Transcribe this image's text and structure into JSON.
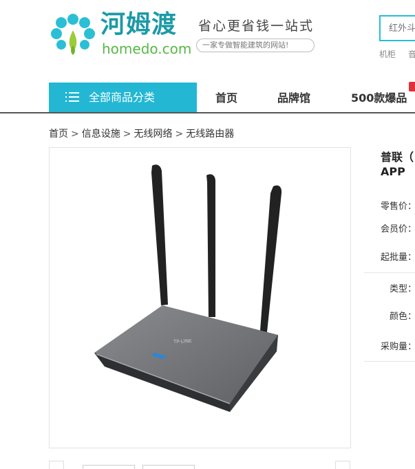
{
  "header": {
    "brand_cn": "河姆渡",
    "brand_en": "homedo.com",
    "slogan": "省心更省钱一站式",
    "sub_slogan": "一家专做智能建筑的网站!",
    "search_placeholder": "红外斗",
    "hot_words": [
      "机柜",
      "音"
    ]
  },
  "nav": {
    "category_label": "全部商品分类",
    "items": [
      "首页",
      "品牌馆",
      "500款爆品"
    ]
  },
  "breadcrumb": {
    "items": [
      "首页",
      "信息设施",
      "无线网络",
      "无线路由器"
    ],
    "separator": ">"
  },
  "product": {
    "title": "普联（ APP",
    "image_brand": "TP-LINK",
    "labels": {
      "retail_price": "零售价：",
      "member_price": "会员价：",
      "min_qty": "起批量：",
      "type": "类型：",
      "color": "颜色：",
      "purchase_qty": "采购量："
    }
  },
  "colors": {
    "accent": "#23b7d3",
    "brand_teal": "#1c9aa6",
    "brand_green": "#57b846",
    "hot_red": "#e0303a"
  }
}
